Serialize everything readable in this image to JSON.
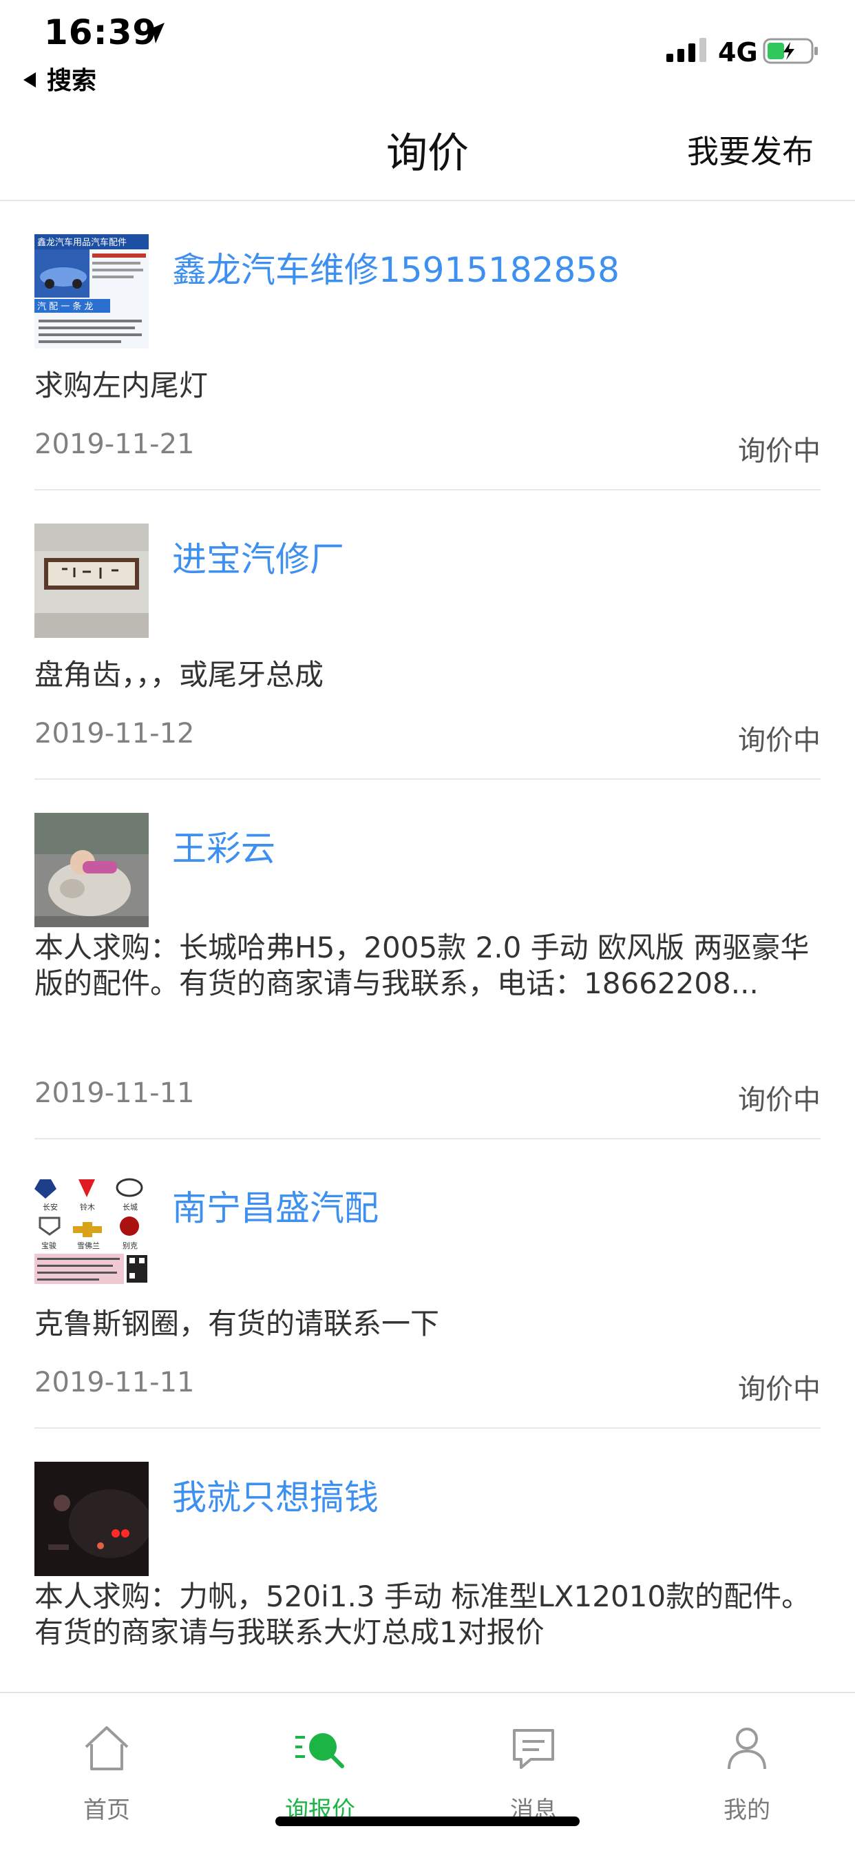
{
  "status_bar": {
    "time": "16:39",
    "back_label": "搜索",
    "network": "4G"
  },
  "nav": {
    "title": "询价",
    "publish_label": "我要发布"
  },
  "items": [
    {
      "name": "鑫龙汽车维修15915182858",
      "desc": "求购左内尾灯",
      "date": "2019-11-21",
      "status": "询价中"
    },
    {
      "name": "进宝汽修厂",
      "desc": "盘角齿，，，或尾牙总成",
      "date": "2019-11-12",
      "status": "询价中"
    },
    {
      "name": "王彩云",
      "desc": "本人求购：长城哈弗H5，2005款 2.0 手动 欧风版 两驱豪华版的配件。有货的商家请与我联系，电话：18662208...",
      "date": "2019-11-11",
      "status": "询价中"
    },
    {
      "name": "南宁昌盛汽配",
      "desc": "克鲁斯钢圈，有货的请联系一下",
      "date": "2019-11-11",
      "status": "询价中"
    },
    {
      "name": "我就只想搞钱",
      "desc": "本人求购：力帆，520i1.3 手动 标准型LX12010款的配件。有货的商家请与我联系大灯总成1对报价"
    }
  ],
  "avatar_text": {
    "item0_banner": "鑫龙汽车用品汽车配件",
    "item0_badge": "汽 配 一 条 龙",
    "item3_brands": [
      "长安",
      "铃木",
      "长城",
      "宝骏",
      "雪佛兰",
      "别克"
    ]
  },
  "tabs": [
    {
      "label": "首页",
      "icon": "home-icon"
    },
    {
      "label": "询报价",
      "icon": "inquiry-icon"
    },
    {
      "label": "消息",
      "icon": "message-icon"
    },
    {
      "label": "我的",
      "icon": "profile-icon"
    }
  ],
  "colors": {
    "accent_green": "#1db446",
    "link_blue": "#3d8ff0"
  }
}
